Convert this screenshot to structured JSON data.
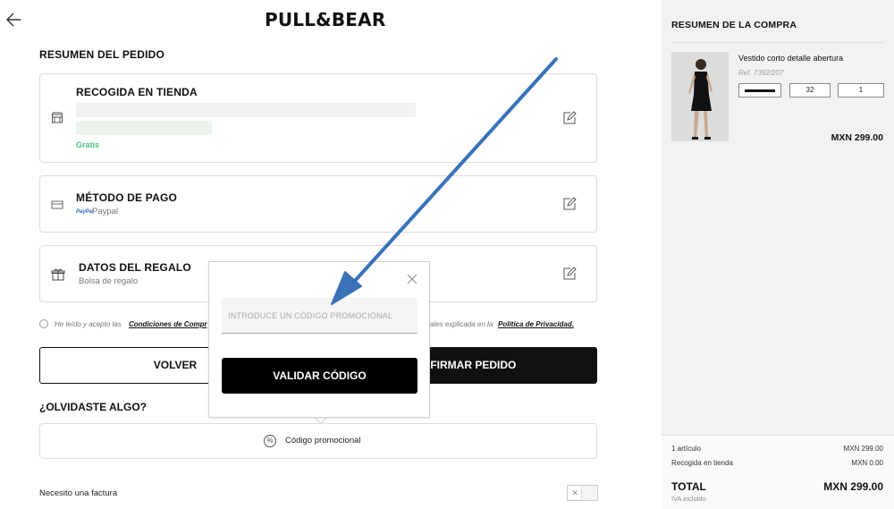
{
  "header": {
    "logo": "PULL&BEAR",
    "back_icon": "arrow-left-icon"
  },
  "order": {
    "title": "RESUMEN DEL PEDIDO",
    "pickup": {
      "title": "RECOGIDA EN TIENDA",
      "price_label": "Gratis",
      "icon": "store-icon"
    },
    "payment": {
      "title": "MÉTODO DE PAGO",
      "method": "Paypal",
      "icon": "credit-card-icon"
    },
    "gift": {
      "title": "DATOS DEL REGALO",
      "detail": "Bolsa de regalo",
      "icon": "gift-icon"
    },
    "terms": {
      "prefix": "He leído y acepto las",
      "conditions_link": "Condiciones de Compr",
      "middle": "ales explicada en la",
      "privacy_link": "Política de Privacidad."
    },
    "back_button": "VOLVER",
    "confirm_button": "CONFIRMAR PEDIDO",
    "confirm_visible": "NFIRMAR PEDIDO"
  },
  "extras": {
    "title": "¿OLVIDASTE ALGO?",
    "promo_label": "Código promocional",
    "invoice_label": "Necesito una factura"
  },
  "promo_popup": {
    "placeholder": "INTRODUCE UN CÓDIGO PROMOCIONAL",
    "validate_button": "VALIDAR CÓDIGO"
  },
  "cart": {
    "title": "RESUMEN DE LA COMPRA",
    "item": {
      "name": "Vestido corto detalle abertura",
      "ref": "Ref. 7392/207",
      "size": "32",
      "quantity": "1",
      "price": "MXN 299.00"
    },
    "summary": {
      "items_label": "1 artículo",
      "items_value": "MXN 299.00",
      "pickup_label": "Recogida en tienda",
      "pickup_value": "MXN 0.00",
      "total_label": "TOTAL",
      "total_value": "MXN 299.00",
      "tax_note": "IVA incluido"
    }
  },
  "colors": {
    "accent": "#111111",
    "free_green": "#4fc07d",
    "annotation_arrow": "#3a72b8",
    "sidebar_bg": "#f2f2f2"
  }
}
